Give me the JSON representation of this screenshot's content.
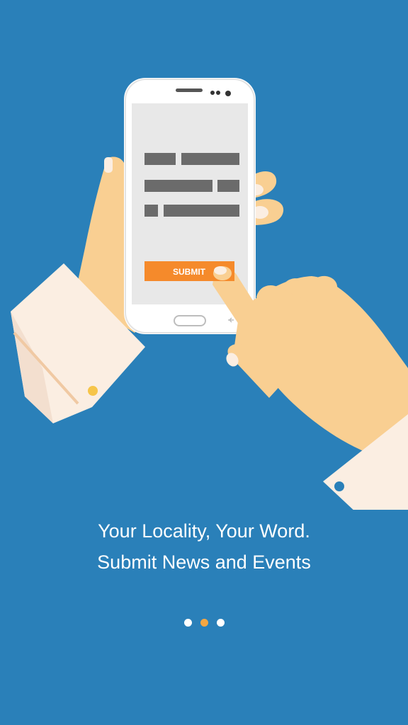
{
  "onboarding": {
    "submit_label": "SUBMIT",
    "headline_line1": "Your Locality, Your Word.",
    "headline_line2": "Submit News and Events",
    "pager": {
      "total": 3,
      "active_index": 1
    }
  },
  "colors": {
    "background": "#2a80b9",
    "accent": "#f6a33c",
    "submit_button": "#f58a2b",
    "skin": "#f9cf92",
    "cuff": "#fbeee2",
    "dot_inactive": "#ffffff",
    "dot_active": "#f5a742"
  }
}
